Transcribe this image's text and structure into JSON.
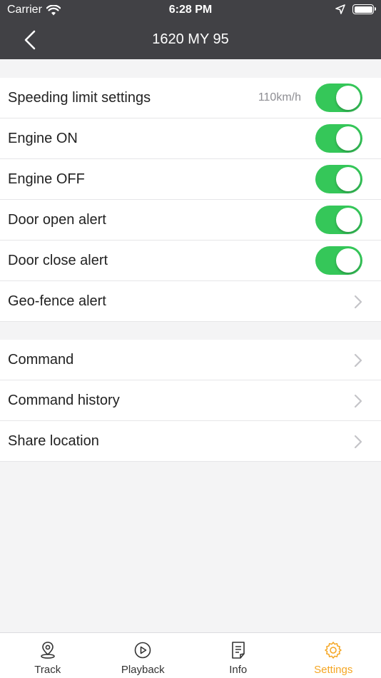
{
  "status_bar": {
    "carrier": "Carrier",
    "time": "6:28 PM"
  },
  "navbar": {
    "title": "1620 MY 95"
  },
  "alerts": [
    {
      "label": "Speeding limit settings",
      "value": "110km/h",
      "toggle": true
    },
    {
      "label": "Engine ON",
      "toggle": true
    },
    {
      "label": "Engine OFF",
      "toggle": true
    },
    {
      "label": "Door open alert",
      "toggle": true
    },
    {
      "label": "Door close alert",
      "toggle": true
    },
    {
      "label": "Geo-fence alert",
      "toggle": null
    }
  ],
  "actions": [
    {
      "label": "Command"
    },
    {
      "label": "Command history"
    },
    {
      "label": "Share location"
    }
  ],
  "tabs": [
    {
      "label": "Track",
      "icon": "map-pin-icon",
      "active": false
    },
    {
      "label": "Playback",
      "icon": "play-circle-icon",
      "active": false
    },
    {
      "label": "Info",
      "icon": "document-icon",
      "active": false
    },
    {
      "label": "Settings",
      "icon": "gear-icon",
      "active": true
    }
  ],
  "colors": {
    "toggle_on": "#35c759",
    "accent": "#f5a623",
    "header": "#414145"
  }
}
